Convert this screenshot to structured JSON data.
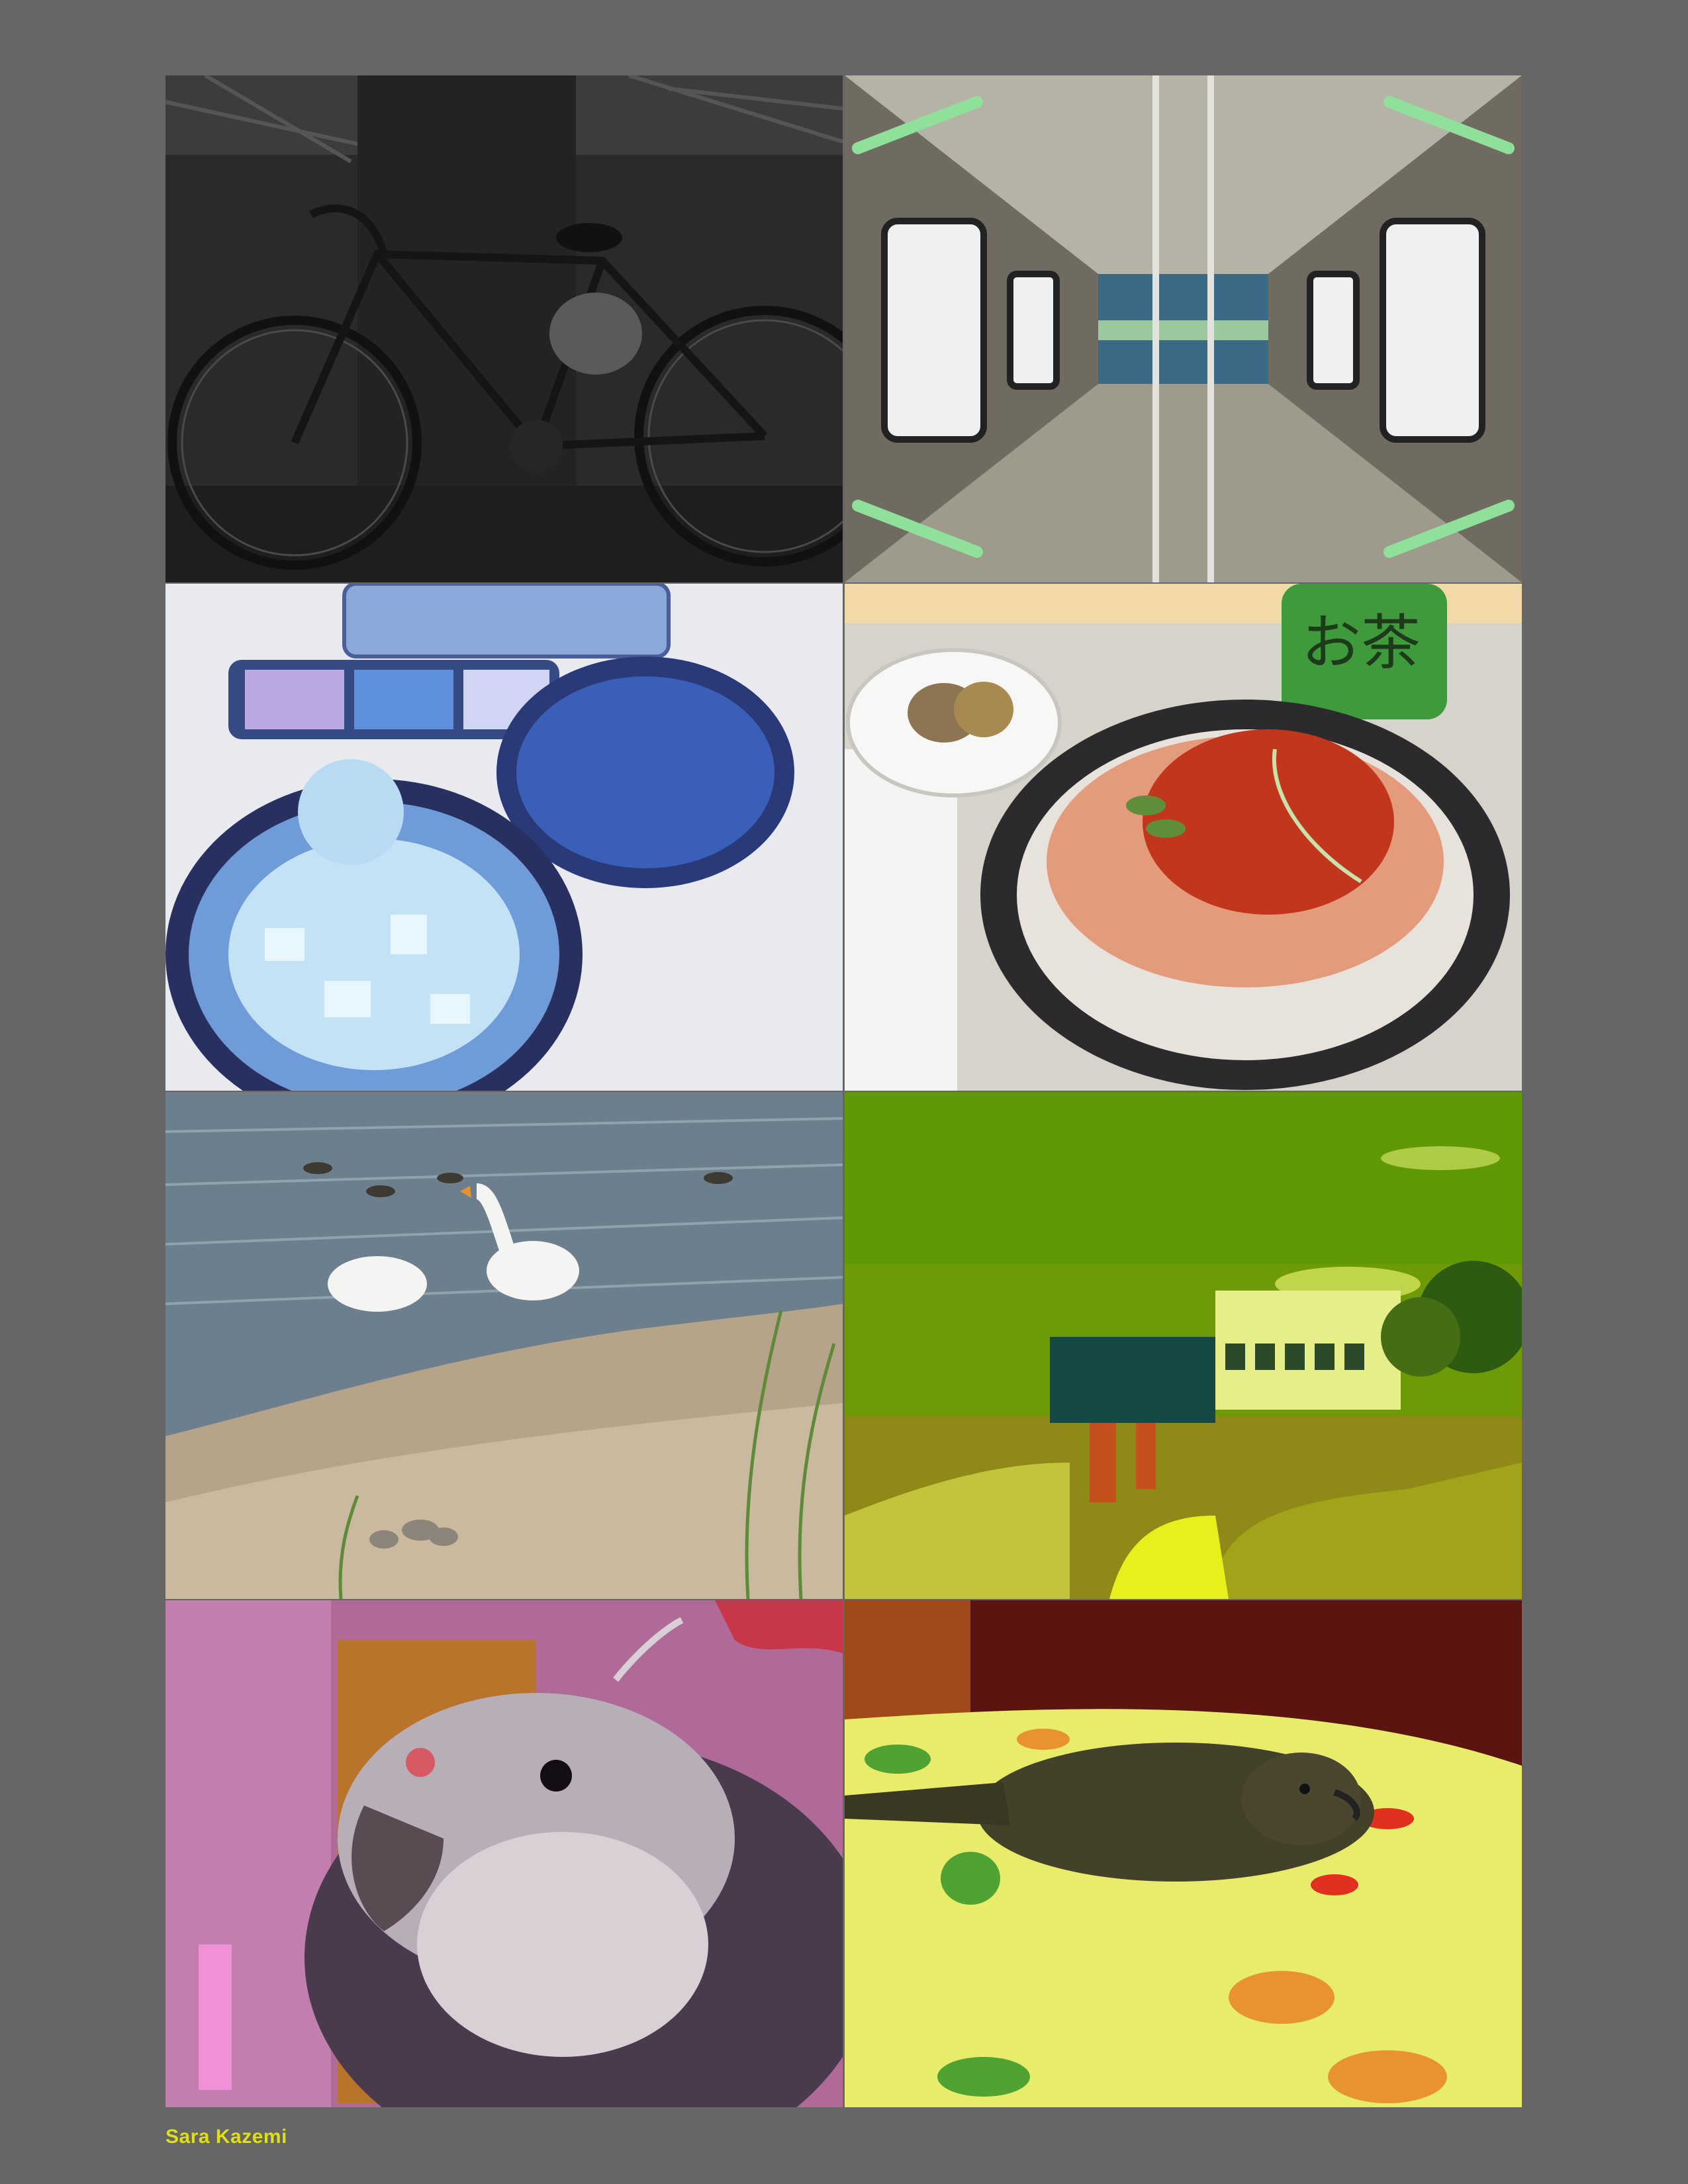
{
  "caption": {
    "text": "Sara Kazemi",
    "color": "#dede1a"
  },
  "background_color": "#666666",
  "photos": [
    {
      "subject": "bicycle-parked-under-solar-canopy",
      "tint": "grayscale-dark"
    },
    {
      "subject": "kaleidoscope-train-interior",
      "tint": "natural-metallic"
    },
    {
      "subject": "shaved-ice-dessert-tray",
      "tint": "inverted-blue"
    },
    {
      "subject": "salmon-roe-rice-bowl-with-tea-bottle",
      "tint": "natural"
    },
    {
      "subject": "geese-on-lake-shore",
      "tint": "natural"
    },
    {
      "subject": "modern-buildings-on-hillside",
      "tint": "yellow-green"
    },
    {
      "subject": "cockatiel-close-up",
      "tint": "magenta"
    },
    {
      "subject": "bird-resting-on-towel",
      "tint": "yellow-red"
    }
  ],
  "bowl_label": "お茶"
}
